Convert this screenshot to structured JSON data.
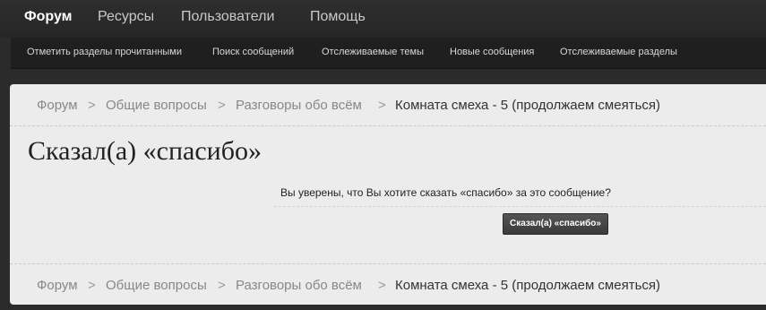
{
  "topnav": {
    "tabs": [
      "Форум",
      "Ресурсы",
      "Пользователи",
      "Помощь"
    ]
  },
  "subnav": {
    "links": [
      "Отметить разделы прочитанными",
      "Поиск сообщений",
      "Отслеживаемые темы",
      "Новые сообщения",
      "Отслеживаемые разделы"
    ]
  },
  "breadcrumb": {
    "items": [
      "Форум",
      "Общие вопросы",
      "Разговоры обо всём"
    ],
    "separator": ">",
    "current": "Комната смеха - 5 (продолжаем смеяться)"
  },
  "page": {
    "title": "Сказал(а) «спасибо»",
    "question": "Вы уверены, что Вы хотите сказать «спасибо» за это сообщение?",
    "button": "Сказал(а) «спасибо»"
  },
  "colors": {
    "background": "#2b2b2b",
    "panel": "#ececec",
    "button": "#444444"
  }
}
